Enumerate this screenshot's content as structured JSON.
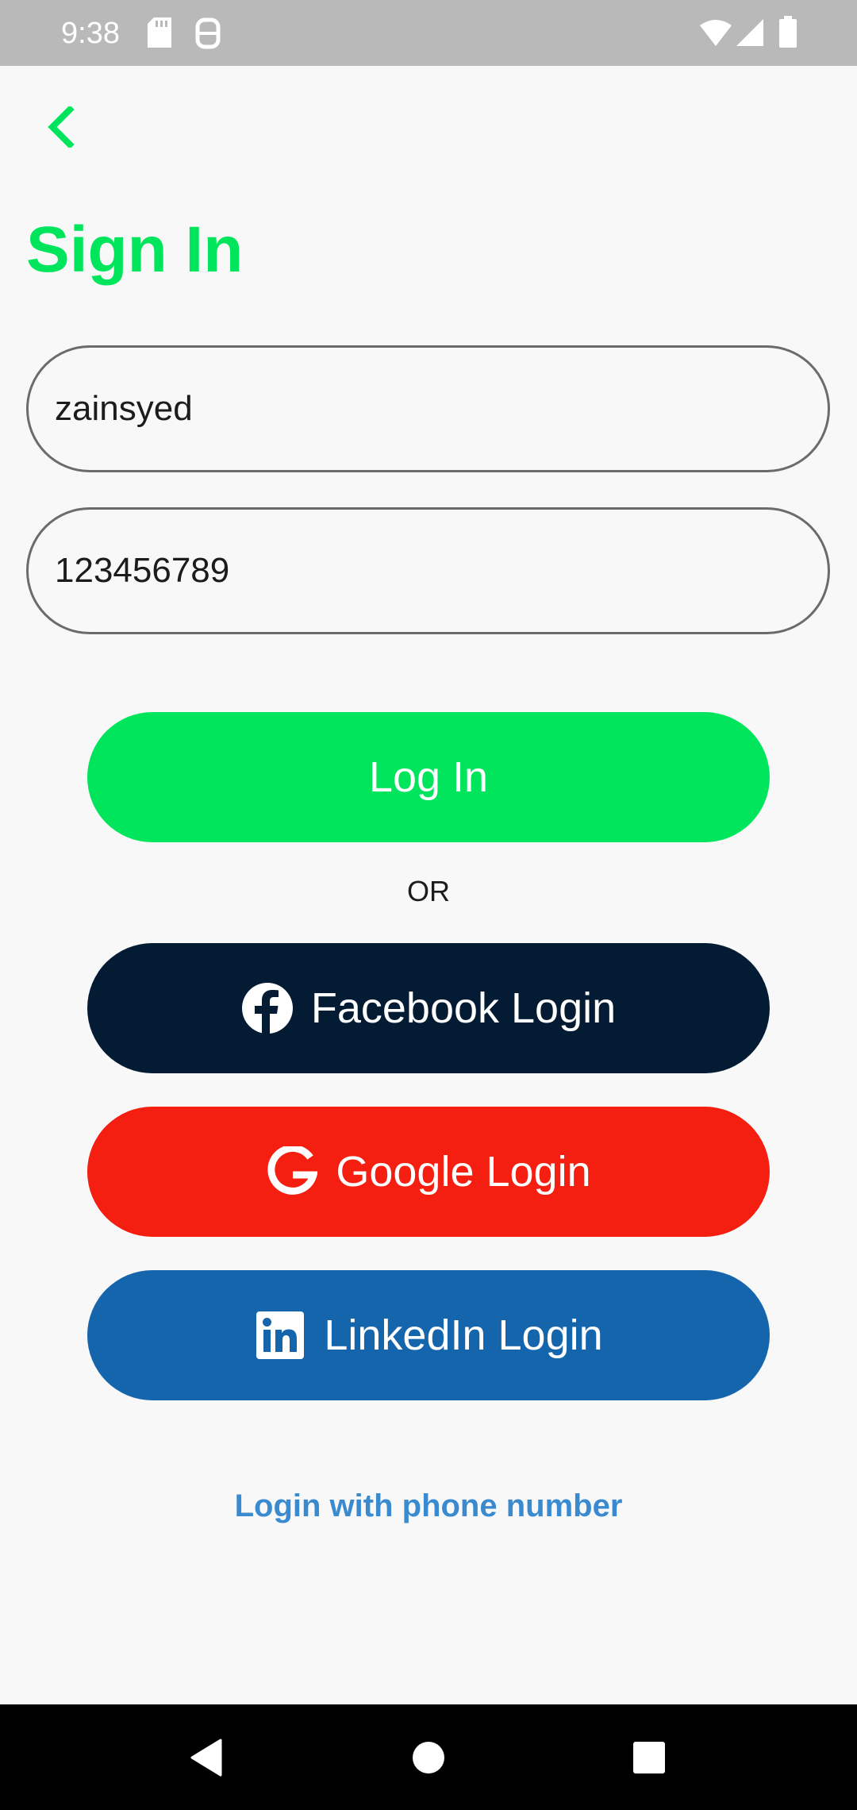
{
  "status_bar": {
    "time": "9:38",
    "icons": [
      "sd-card-icon",
      "vpn-icon",
      "wifi-icon",
      "signal-icon",
      "battery-icon"
    ]
  },
  "header": {
    "back_icon": "chevron-left-icon",
    "title": "Sign In"
  },
  "form": {
    "username_value": "zainsyed",
    "password_value": "123456789"
  },
  "buttons": {
    "login_label": "Log In",
    "or_label": "OR",
    "facebook_label": "Facebook Login",
    "google_label": "Google Login",
    "linkedin_label": "LinkedIn Login",
    "phone_link_label": "Login with phone number"
  },
  "colors": {
    "accent_green": "#00e55b",
    "facebook_navy": "#031b33",
    "google_red": "#f41f10",
    "linkedin_blue": "#1565ad",
    "link_blue": "#3a8ad0"
  },
  "nav_bar": {
    "icons": [
      "back-triangle-icon",
      "home-circle-icon",
      "recents-square-icon"
    ]
  }
}
